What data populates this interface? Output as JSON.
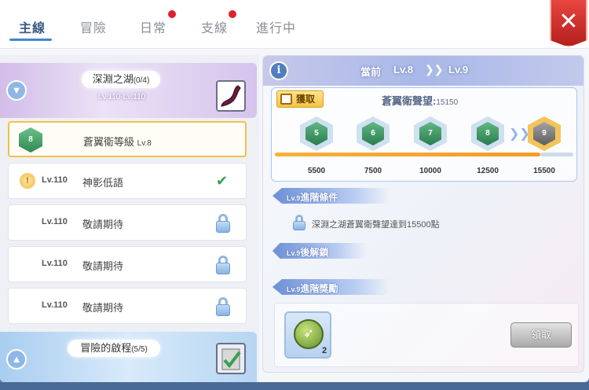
{
  "tabs": [
    {
      "label": "主線",
      "active": true
    },
    {
      "label": "冒險",
      "active": false
    },
    {
      "label": "日常",
      "active": false,
      "notify": true
    },
    {
      "label": "支線",
      "active": false,
      "notify": true
    },
    {
      "label": "進行中",
      "active": false
    }
  ],
  "close_label": "✕",
  "category1": {
    "title": "深淵之湖",
    "count": "(0/4)",
    "range": "Lv.110-Lv.110"
  },
  "quests": [
    {
      "level": "Lv.8",
      "badge": "8",
      "name": "蒼翼衛等級",
      "selected": true,
      "status": "none"
    },
    {
      "level": "Lv.110",
      "name": "神影低語",
      "status": "done"
    },
    {
      "level": "Lv.110",
      "name": "敬請期待",
      "status": "locked"
    },
    {
      "level": "Lv.110",
      "name": "敬請期待",
      "status": "locked"
    },
    {
      "level": "Lv.110",
      "name": "敬請期待",
      "status": "locked"
    }
  ],
  "category2": {
    "title": "冒險的啟程",
    "count": "(5/5)"
  },
  "header": {
    "current_label": "當前",
    "from_level": "Lv.8",
    "to_level": "Lv.9"
  },
  "fame": {
    "get_label": "獲取",
    "title": "蒼翼衛聲望:",
    "value": "15150",
    "progress": 0.9,
    "milestones": [
      {
        "level": "5",
        "value": "5500"
      },
      {
        "level": "6",
        "value": "7500"
      },
      {
        "level": "7",
        "value": "10000"
      },
      {
        "level": "8",
        "value": "12500"
      },
      {
        "level": "9",
        "value": "15500",
        "locked": true
      }
    ]
  },
  "sections": {
    "condition_title_lv": "Lv.9",
    "condition_title": "進階條件",
    "condition_text": "深淵之湖蒼翼衛聲望達到15500點",
    "unlock_title_lv": "Lv.9",
    "unlock_title": "後解鎖",
    "reward_title_lv": "Lv.9",
    "reward_title": "進階獎勵"
  },
  "reward": {
    "qty": "2",
    "claim_label": "領取"
  },
  "colors": {
    "accent": "#3d86d8",
    "progress": "#f6b13b",
    "badge_green": "#2c8a52",
    "notify": "#e0202a"
  }
}
